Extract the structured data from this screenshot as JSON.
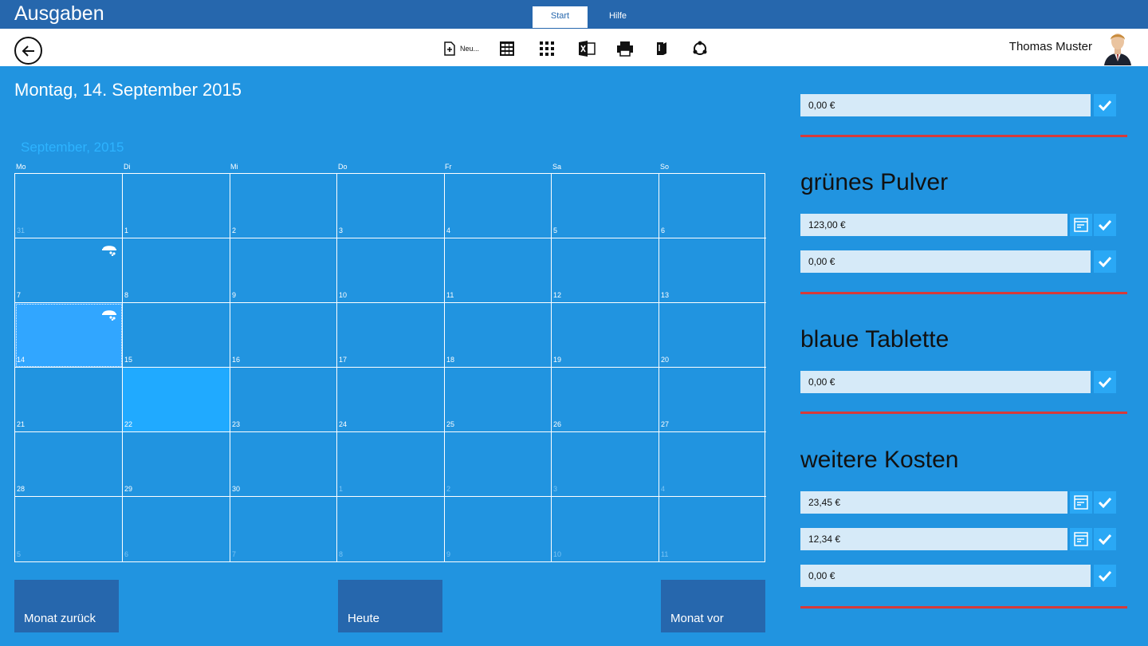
{
  "app": {
    "title": "Ausgaben"
  },
  "tabs": [
    {
      "label": "Start",
      "active": true
    },
    {
      "label": "Hilfe",
      "active": false
    }
  ],
  "toolbar": {
    "new_label": "Neu...",
    "icons": [
      "new-document-icon",
      "calculator-icon",
      "grid-icon",
      "excel-icon",
      "print-icon",
      "book-icon",
      "sync-icon"
    ]
  },
  "user": {
    "name": "Thomas Muster"
  },
  "date_heading": "Montag, 14. September 2015",
  "calendar": {
    "month_label": "September, 2015",
    "weekdays": [
      "Mo",
      "Di",
      "Mi",
      "Do",
      "Fr",
      "Sa",
      "So"
    ],
    "weeks": [
      [
        {
          "d": "31",
          "o": true
        },
        {
          "d": "1"
        },
        {
          "d": "2"
        },
        {
          "d": "3"
        },
        {
          "d": "4"
        },
        {
          "d": "5"
        },
        {
          "d": "6"
        }
      ],
      [
        {
          "d": "7",
          "icon": true
        },
        {
          "d": "8"
        },
        {
          "d": "9"
        },
        {
          "d": "10"
        },
        {
          "d": "11"
        },
        {
          "d": "12"
        },
        {
          "d": "13"
        }
      ],
      [
        {
          "d": "14",
          "icon": true,
          "selected": true
        },
        {
          "d": "15"
        },
        {
          "d": "16"
        },
        {
          "d": "17"
        },
        {
          "d": "18"
        },
        {
          "d": "19"
        },
        {
          "d": "20"
        }
      ],
      [
        {
          "d": "21"
        },
        {
          "d": "22",
          "today": true
        },
        {
          "d": "23"
        },
        {
          "d": "24"
        },
        {
          "d": "25"
        },
        {
          "d": "26"
        },
        {
          "d": "27"
        }
      ],
      [
        {
          "d": "28"
        },
        {
          "d": "29"
        },
        {
          "d": "30"
        },
        {
          "d": "1",
          "o": true
        },
        {
          "d": "2",
          "o": true
        },
        {
          "d": "3",
          "o": true
        },
        {
          "d": "4",
          "o": true
        }
      ],
      [
        {
          "d": "5",
          "o": true
        },
        {
          "d": "6",
          "o": true
        },
        {
          "d": "7",
          "o": true
        },
        {
          "d": "8",
          "o": true
        },
        {
          "d": "9",
          "o": true
        },
        {
          "d": "10",
          "o": true
        },
        {
          "d": "11",
          "o": true
        }
      ]
    ]
  },
  "nav": {
    "prev": "Monat zurück",
    "today": "Heute",
    "next": "Monat vor"
  },
  "panel": {
    "top_amount": "0,00 €",
    "sections": [
      {
        "title": "grünes Pulver",
        "amounts": [
          "123,00 €",
          "0,00 €"
        ]
      },
      {
        "title": "blaue Tablette",
        "amounts": [
          "0,00 €"
        ]
      },
      {
        "title": "weitere Kosten",
        "amounts": [
          "23,45 €",
          "12,34 €",
          "0,00 €"
        ]
      }
    ]
  },
  "colors": {
    "background": "#2194e0",
    "bar": "#2667ad",
    "accent_line": "#d63a3a",
    "field": "#d6eaf8"
  }
}
